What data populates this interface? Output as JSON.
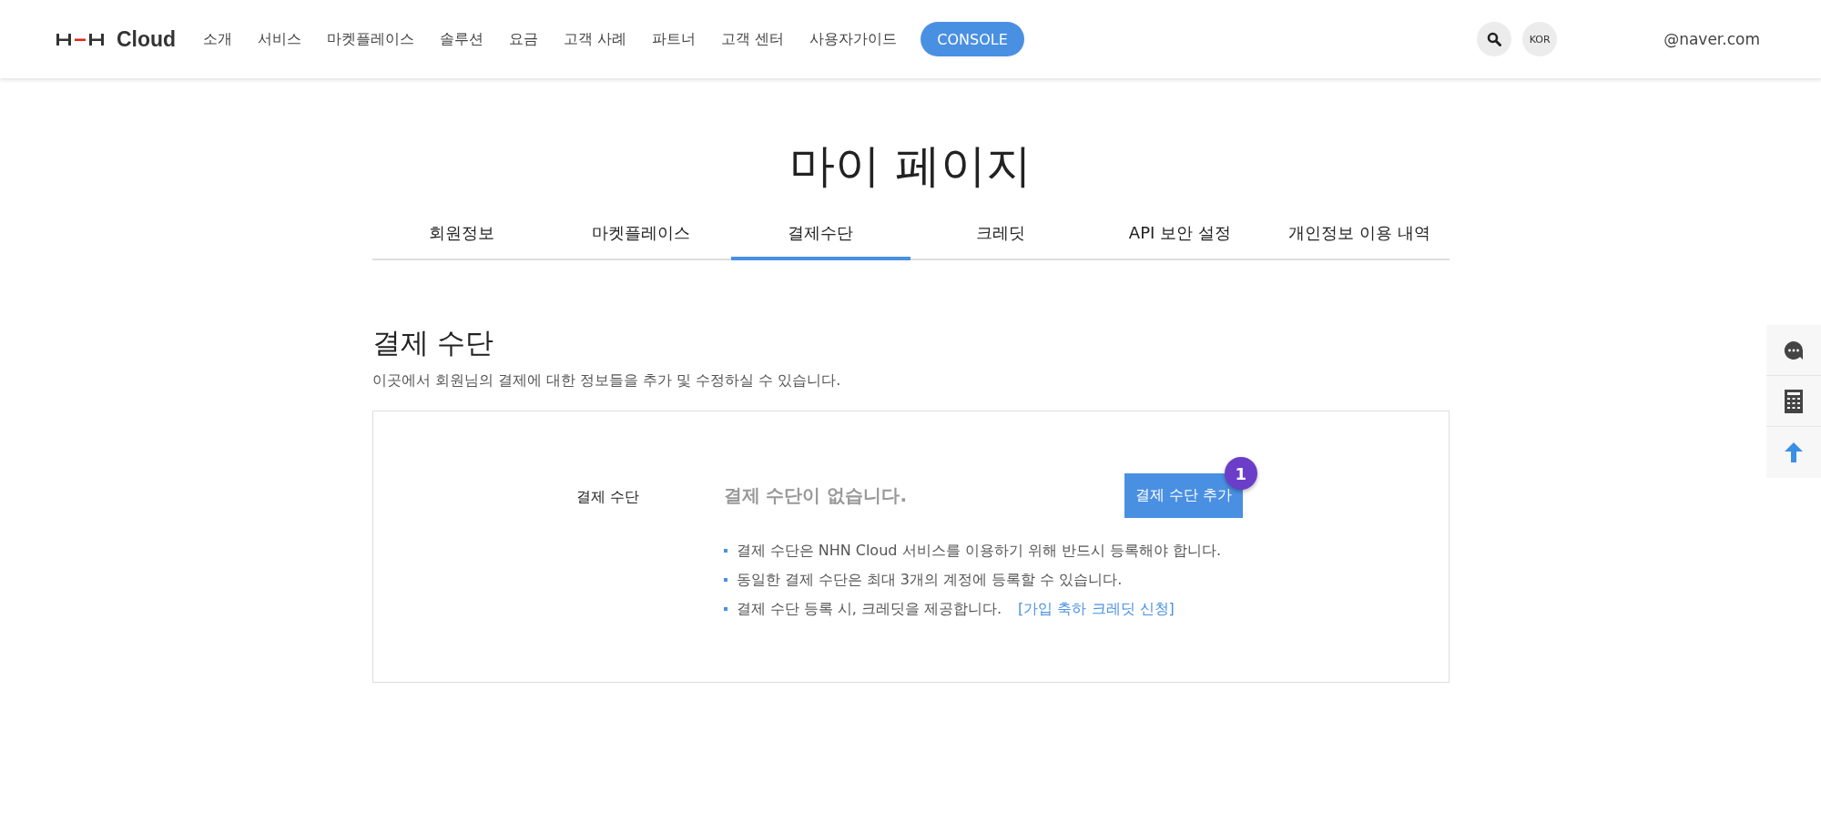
{
  "header": {
    "logo": "Cloud",
    "nav": [
      "소개",
      "서비스",
      "마켓플레이스",
      "솔루션",
      "요금",
      "고객 사례",
      "파트너",
      "고객 센터",
      "사용자가이드"
    ],
    "console_button": "CONSOLE",
    "language": "KOR",
    "user": "@naver.com"
  },
  "page_title": "마이 페이지",
  "tabs": [
    {
      "label": "회원정보",
      "selected": false
    },
    {
      "label": "마켓플레이스",
      "selected": false
    },
    {
      "label": "결제수단",
      "selected": true
    },
    {
      "label": "크레딧",
      "selected": false
    },
    {
      "label": "API 보안 설정",
      "selected": false
    },
    {
      "label": "개인정보 이용 내역",
      "selected": false
    }
  ],
  "section": {
    "title": "결제 수단",
    "description": "이곳에서 회원님의 결제에 대한 정보들을 추가 및 수정하실 수 있습니다.",
    "field_label": "결제 수단",
    "empty_message": "결제 수단이 없습니다.",
    "add_button": "결제 수단 추가",
    "badge": "1",
    "notes": [
      {
        "text": "결제 수단은 NHN Cloud 서비스를 이용하기 위해 반드시 등록해야 합니다."
      },
      {
        "text": "동일한 결제 수단은 최대 3개의 계정에 등록할 수 있습니다."
      },
      {
        "text": "결제 수단 등록 시, 크레딧을 제공합니다.",
        "link": "[가입 축하 크레딧 신청]"
      }
    ]
  }
}
